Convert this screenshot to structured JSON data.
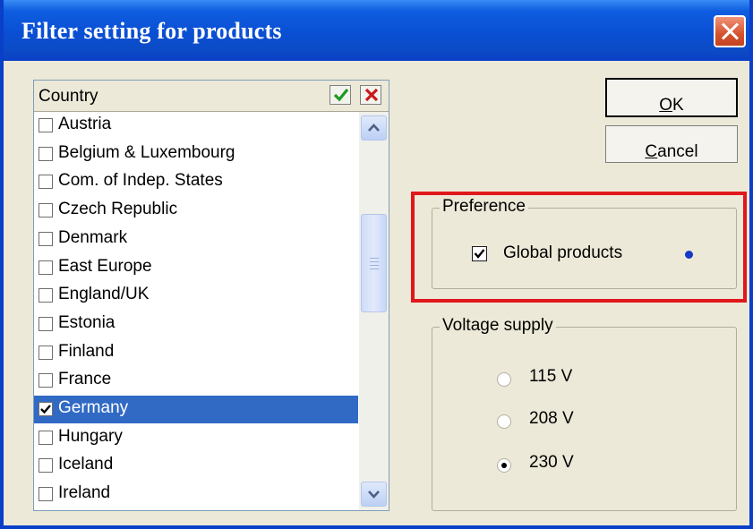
{
  "window": {
    "title": "Filter setting for products"
  },
  "country_list": {
    "header": "Country",
    "items": [
      {
        "label": "Austria",
        "checked": false,
        "selected": false
      },
      {
        "label": "Belgium & Luxembourg",
        "checked": false,
        "selected": false
      },
      {
        "label": "Com. of Indep. States",
        "checked": false,
        "selected": false
      },
      {
        "label": "Czech Republic",
        "checked": false,
        "selected": false
      },
      {
        "label": "Denmark",
        "checked": false,
        "selected": false
      },
      {
        "label": "East Europe",
        "checked": false,
        "selected": false
      },
      {
        "label": "England/UK",
        "checked": false,
        "selected": false
      },
      {
        "label": "Estonia",
        "checked": false,
        "selected": false
      },
      {
        "label": "Finland",
        "checked": false,
        "selected": false
      },
      {
        "label": "France",
        "checked": false,
        "selected": false
      },
      {
        "label": "Germany",
        "checked": true,
        "selected": true
      },
      {
        "label": "Hungary",
        "checked": false,
        "selected": false
      },
      {
        "label": "Iceland",
        "checked": false,
        "selected": false
      },
      {
        "label": "Ireland",
        "checked": false,
        "selected": false
      }
    ]
  },
  "buttons": {
    "ok": {
      "mnemonic": "O",
      "rest": "K"
    },
    "cancel": {
      "mnemonic": "C",
      "rest": "ancel"
    }
  },
  "preference": {
    "legend": "Preference",
    "global_products": {
      "label": "Global products",
      "checked": true
    }
  },
  "voltage": {
    "legend": "Voltage supply",
    "options": [
      {
        "label": "115 V",
        "selected": false
      },
      {
        "label": "208 V",
        "selected": false
      },
      {
        "label": "230 V",
        "selected": true
      }
    ]
  },
  "colors": {
    "selection": "#316ac5",
    "highlight": "#e0171b",
    "titlebar": "#0a4fd3"
  }
}
